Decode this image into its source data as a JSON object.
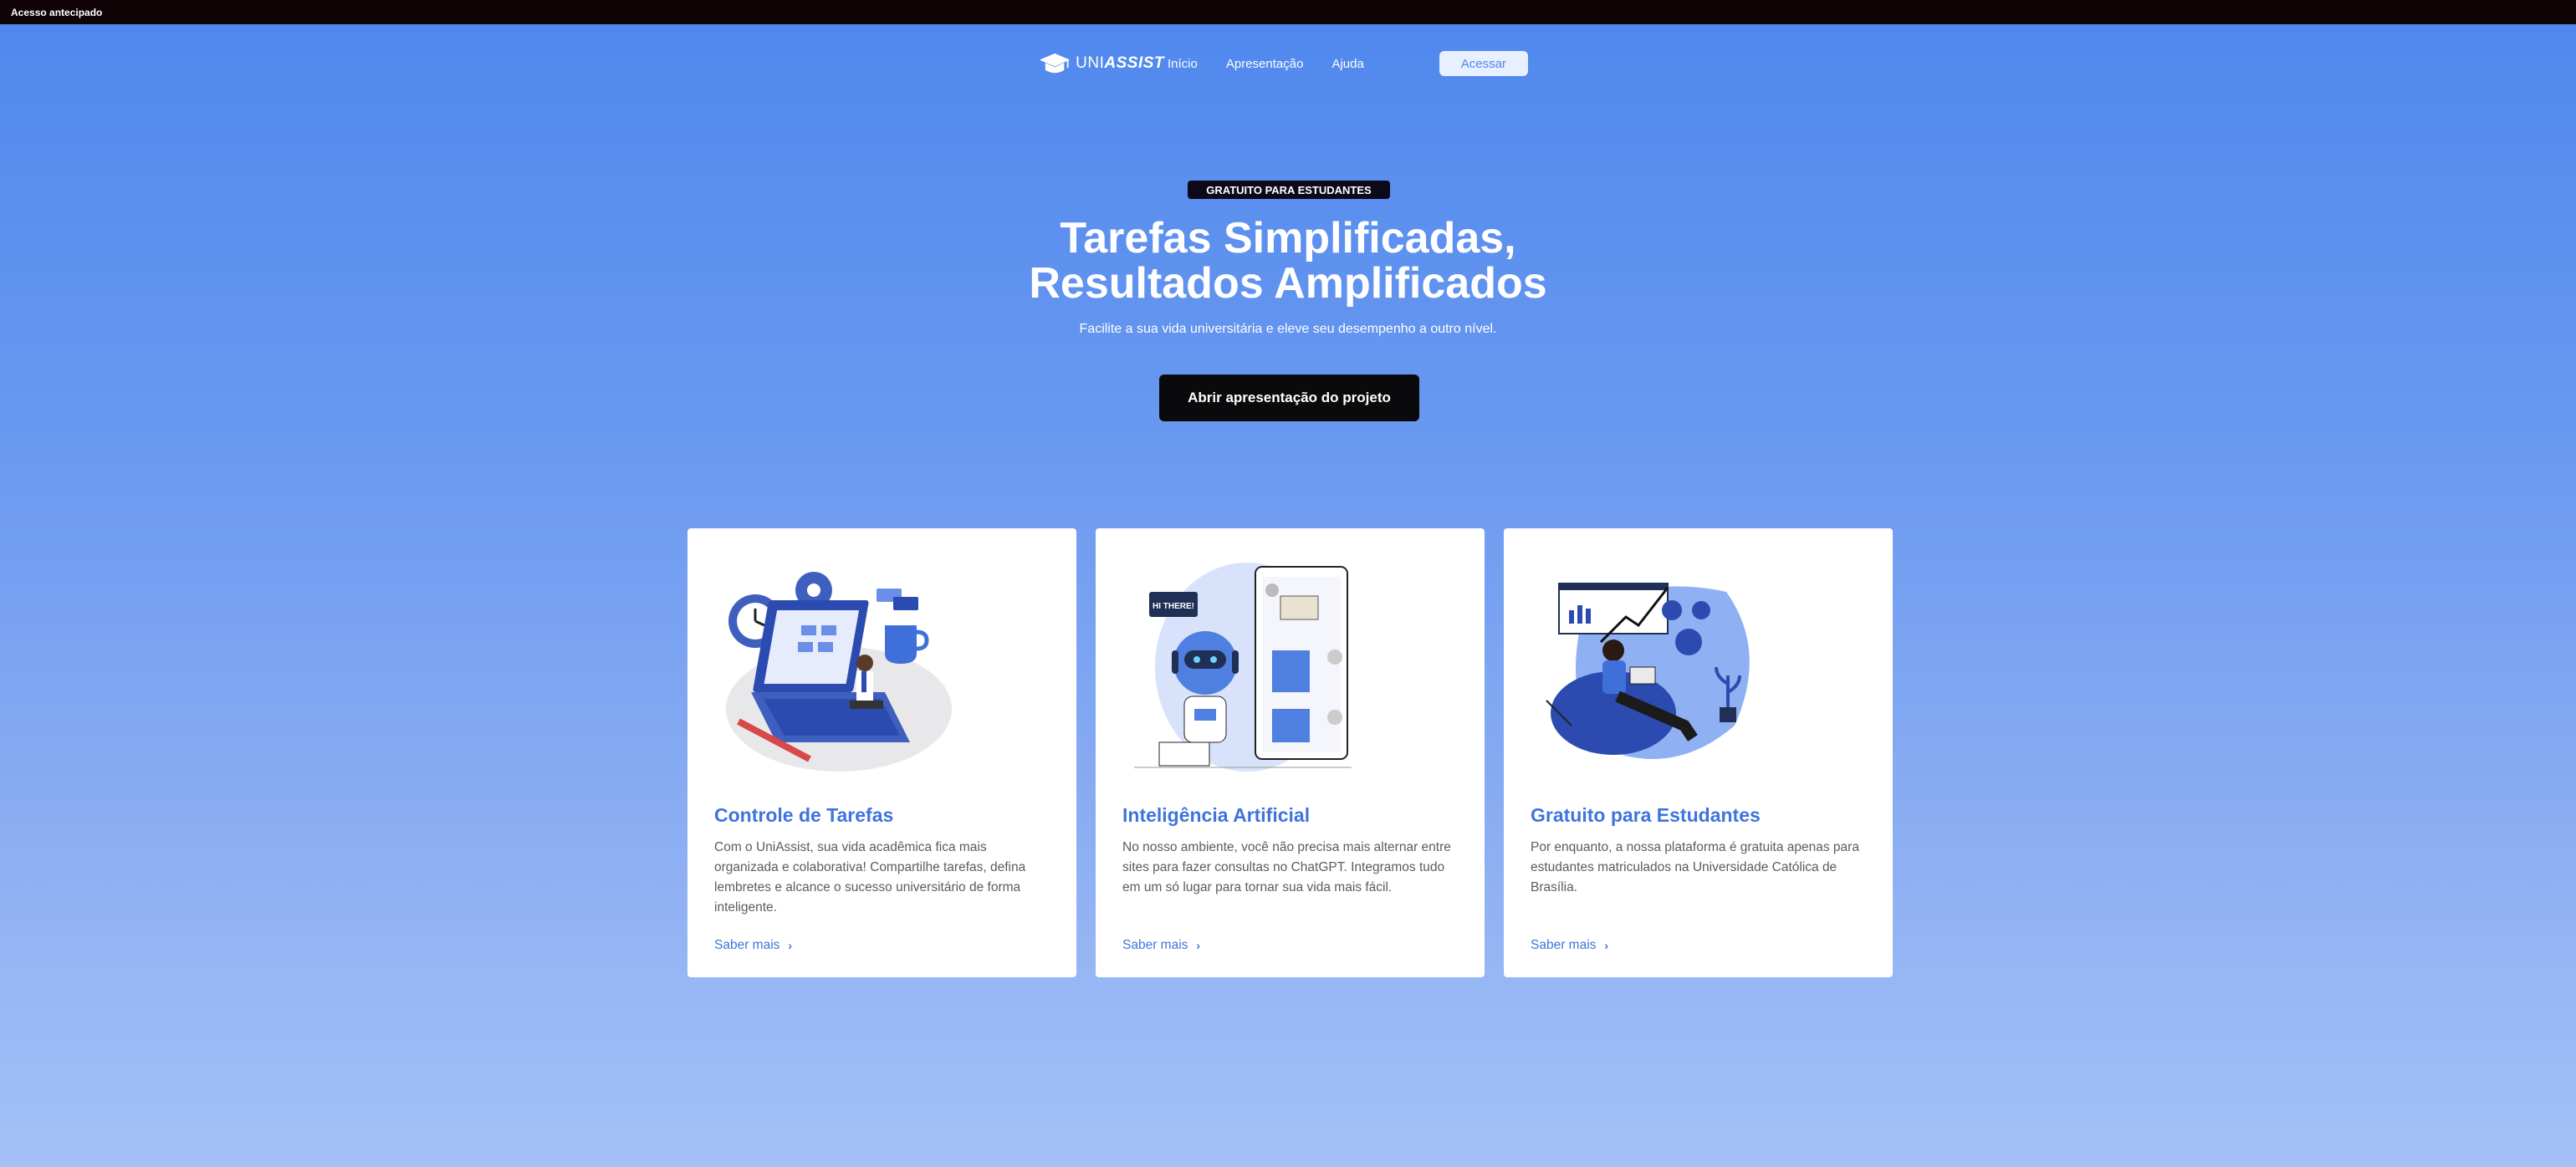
{
  "topbar": {
    "label": "Acesso antecipado"
  },
  "nav": {
    "logo_prefix": "UNI",
    "logo_suffix": "ASSIST",
    "links": [
      "Início",
      "Apresentação",
      "Ajuda"
    ],
    "cta": "Acessar"
  },
  "hero": {
    "badge": "GRATUITO PARA ESTUDANTES",
    "title_line1": "Tarefas Simplificadas,",
    "title_line2": "Resultados Amplificados",
    "subtitle": "Facilite a sua vida universitária e eleve seu desempenho a outro nível.",
    "button": "Abrir apresentação do projeto"
  },
  "cards": [
    {
      "title": "Controle de Tarefas",
      "text": "Com o UniAssist, sua vida acadêmica fica mais organizada e colaborativa! Compartilhe tarefas, defina lembretes e alcance o sucesso universitário de forma inteligente.",
      "link": "Saber mais"
    },
    {
      "title": "Inteligência Artificial",
      "text": "No nosso ambiente, você não precisa mais alternar entre sites para fazer consultas no ChatGPT. Integramos tudo em um só lugar para tornar sua vida mais fácil.",
      "link": "Saber mais",
      "bubble": "HI THERE!"
    },
    {
      "title": "Gratuito para Estudantes",
      "text": "Por enquanto, a nossa plataforma é gratuita apenas para estudantes matriculados na Universidade Católica de Brasília.",
      "link": "Saber mais"
    }
  ],
  "colors": {
    "accent": "#3f74dc",
    "topbar": "#0f0306",
    "cta": "#0a0a0c"
  }
}
